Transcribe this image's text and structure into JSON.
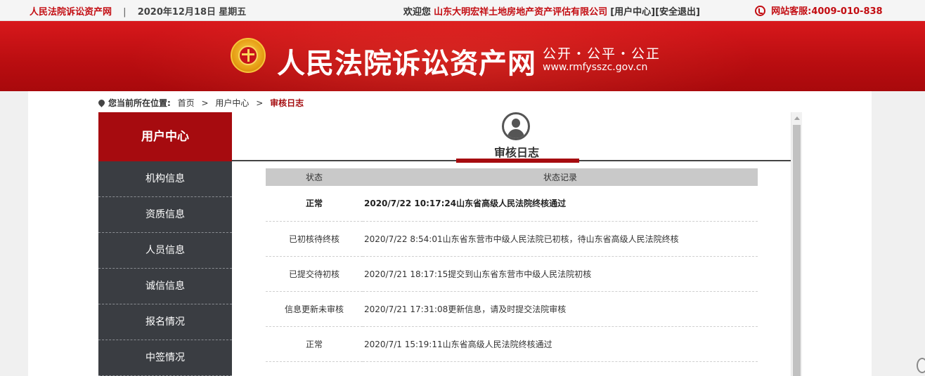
{
  "topbar": {
    "site_name": "人民法院诉讼资产网",
    "separator": "|",
    "date": "2020年12月18日",
    "weekday": "星期五",
    "welcome": "欢迎您",
    "company": "山东大明宏祥土地房地产资产评估有限公司",
    "user_center_link": "[用户中心]",
    "logout_link": "[安全退出]",
    "hotline": "网站客服:4009-010-838"
  },
  "banner": {
    "brand": "人民法院诉讼资产网",
    "slogan": "公开・公平・公正",
    "domain": "www.rmfysszc.gov.cn"
  },
  "breadcrumb": {
    "label": "您当前所在位置:",
    "items": [
      "首页",
      "用户中心"
    ],
    "separator": ">",
    "current": "审核日志"
  },
  "sidebar": {
    "title": "用户中心",
    "items": [
      {
        "label": "机构信息"
      },
      {
        "label": "资质信息"
      },
      {
        "label": "人员信息"
      },
      {
        "label": "诚信信息"
      },
      {
        "label": "报名情况"
      },
      {
        "label": "中签情况"
      }
    ]
  },
  "main": {
    "title": "审核日志",
    "table": {
      "headers": [
        "状态",
        "状态记录"
      ],
      "rows": [
        {
          "status": "正常",
          "record": "2020/7/22 10:17:24山东省高级人民法院终核通过"
        },
        {
          "status": "已初核待终核",
          "record": "2020/7/22 8:54:01山东省东营市中级人民法院已初核，待山东省高级人民法院终核"
        },
        {
          "status": "已提交待初核",
          "record": "2020/7/21 18:17:15提交到山东省东营市中级人民法院初核"
        },
        {
          "status": "信息更新未审核",
          "record": "2020/7/21 17:31:08更新信息，请及时提交法院审核"
        },
        {
          "status": "正常",
          "record": "2020/7/1 15:19:11山东省高级人民法院终核通过"
        }
      ]
    }
  },
  "colors": {
    "brand_red": "#c30d12",
    "sidebar_active": "#a60b0f",
    "sidebar_bg": "#3a3d42"
  },
  "icons": [
    "phone-icon",
    "court-emblem-icon",
    "location-pin-icon",
    "user-avatar-icon"
  ]
}
